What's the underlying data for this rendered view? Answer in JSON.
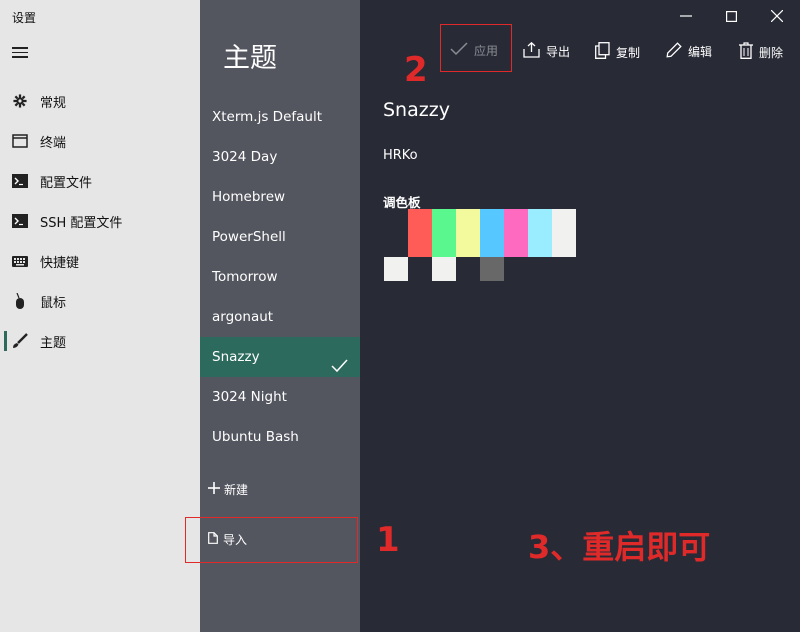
{
  "app": {
    "title": "设置"
  },
  "nav": {
    "items": [
      {
        "label": "常规",
        "icon": "gear-icon"
      },
      {
        "label": "终端",
        "icon": "window-icon"
      },
      {
        "label": "配置文件",
        "icon": "terminal-prompt-icon"
      },
      {
        "label": "SSH 配置文件",
        "icon": "terminal-prompt-icon"
      },
      {
        "label": "快捷键",
        "icon": "keyboard-icon"
      },
      {
        "label": "鼠标",
        "icon": "mouse-icon"
      },
      {
        "label": "主题",
        "icon": "brush-icon",
        "active": true
      }
    ]
  },
  "themes": {
    "title": "主题",
    "items": [
      "Xterm.js Default",
      "3024 Day",
      "Homebrew",
      "PowerShell",
      "Tomorrow",
      "argonaut",
      "Snazzy",
      "3024 Night",
      "Ubuntu Bash"
    ],
    "selected": "Snazzy",
    "new_label": "新建",
    "import_label": "导入"
  },
  "toolbar": {
    "apply": "应用",
    "apply_enabled": false,
    "export": "导出",
    "copy": "复制",
    "edit": "编辑",
    "delete": "删除"
  },
  "detail": {
    "name": "Snazzy",
    "author": "HRKo",
    "palette_label": "调色板",
    "palette_row1": [
      "#282a36",
      "#ff5c57",
      "#5af78e",
      "#f3f99d",
      "#57c7ff",
      "#ff6ac1",
      "#9aedfe",
      "#f1f1f0"
    ],
    "palette_row2": [
      "#f1f1f0",
      "#282a36",
      "#f1f1f0",
      "#282a36",
      "#686868",
      "#282a36",
      "#282a36",
      "#282a36"
    ]
  },
  "annotations": {
    "step1": "1",
    "step2": "2",
    "step3": "3、重启即可"
  },
  "colors": {
    "nav_bg": "#e6e6e6",
    "list_bg": "#53555f",
    "selected_bg": "#2c6a5e",
    "main_bg": "#282a36",
    "annotation": "#e02a2a"
  }
}
